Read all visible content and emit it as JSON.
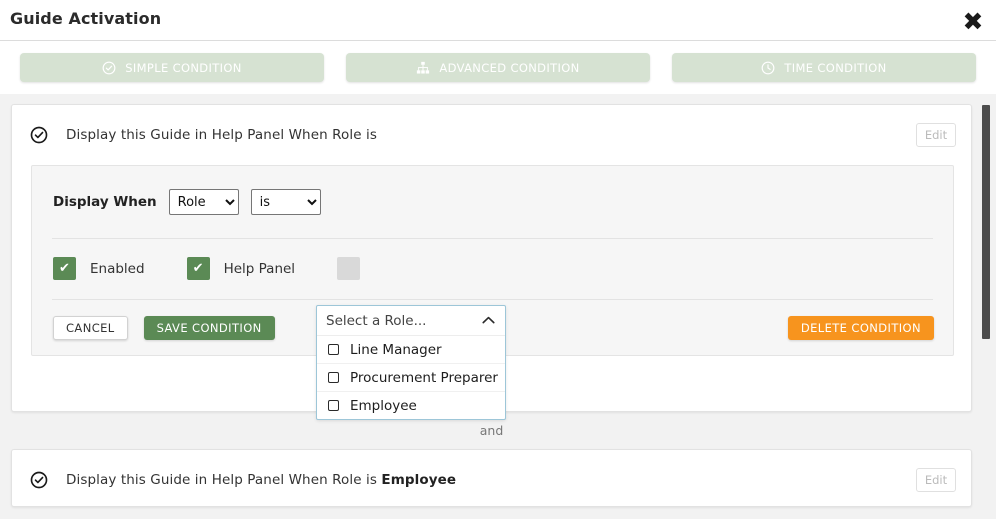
{
  "header": {
    "title": "Guide Activation",
    "close_icon": "close-x-icon"
  },
  "tabs": [
    {
      "label": "SIMPLE CONDITION",
      "icon": "check-circle-icon",
      "active": false
    },
    {
      "label": "ADVANCED CONDITION",
      "icon": "sitemap-icon",
      "active": false
    },
    {
      "label": "TIME CONDITION",
      "icon": "clock-icon",
      "active": false
    }
  ],
  "conditions": [
    {
      "icon": "check-circle-icon",
      "summary_prefix": "Display this Guide in Help Panel When Role is",
      "summary_value": "",
      "edit_label": "Edit",
      "editor": {
        "display_when_label": "Display When",
        "field_select": {
          "value": "Role",
          "options": [
            "Role"
          ]
        },
        "operator_select": {
          "value": "is",
          "options": [
            "is"
          ]
        },
        "role_multiselect": {
          "placeholder": "Select a Role...",
          "expanded": true,
          "caret_icon": "chevron-up-icon",
          "options": [
            {
              "label": "Line Manager",
              "checked": false
            },
            {
              "label": "Procurement Preparer",
              "checked": false
            },
            {
              "label": "Employee",
              "checked": false
            }
          ]
        },
        "toggles": [
          {
            "label": "Enabled",
            "checked": true
          },
          {
            "label": "Help Panel",
            "checked": true
          },
          {
            "label": "",
            "checked": false
          }
        ],
        "cancel_label": "CANCEL",
        "save_label": "SAVE CONDITION",
        "delete_label": "DELETE CONDITION"
      }
    },
    {
      "icon": "check-circle-icon",
      "summary_prefix": "Display this Guide in Help Panel When Role is ",
      "summary_value": "Employee",
      "edit_label": "Edit"
    }
  ],
  "separator": {
    "label": "and"
  },
  "colors": {
    "tab_bg": "#d6e2d2",
    "save_green": "#5b8a55",
    "delete_orange": "#f7941e",
    "panel_bg": "#f6f6f6",
    "scroll_bg": "#f2f2f2",
    "dropdown_border": "#9dc6d8",
    "scrollbar_thumb": "#4d4d4d"
  }
}
